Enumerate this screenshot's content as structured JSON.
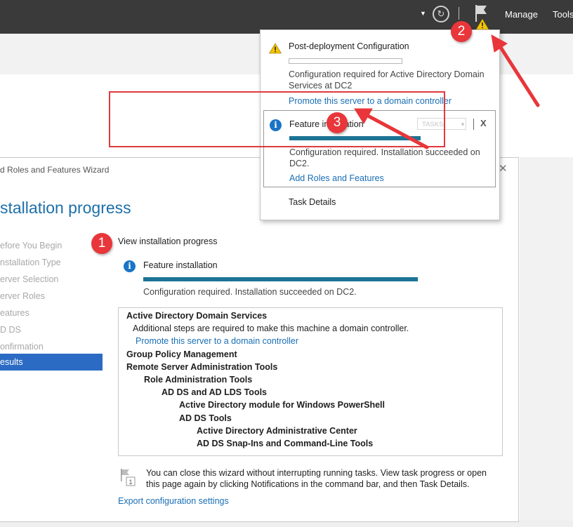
{
  "topbar": {
    "menu_manage": "Manage",
    "menu_tools": "Tools",
    "refresh_glyph": "↻",
    "dropdown_glyph": "▼"
  },
  "wizard": {
    "title": "d Roles and Features Wizard",
    "close_glyph": "✕",
    "heading": "stallation progress",
    "nav": [
      {
        "label": "efore You Begin"
      },
      {
        "label": "nstallation Type"
      },
      {
        "label": "erver Selection"
      },
      {
        "label": "erver Roles"
      },
      {
        "label": "eatures"
      },
      {
        "label": "D DS"
      },
      {
        "label": "onfirmation"
      },
      {
        "label": "esults"
      }
    ],
    "view_label": "View installation progress",
    "feature": {
      "title": "Feature installation",
      "progress": 1.0,
      "status": "Configuration required. Installation succeeded on DC2."
    },
    "results": [
      {
        "text": "Active Directory Domain Services",
        "style": "b",
        "indent": 0
      },
      {
        "text": "Additional steps are required to make this machine a domain controller.",
        "style": "n",
        "indent": 1
      },
      {
        "text": "Promote this server to a domain controller",
        "style": "lnk",
        "indent": 1
      },
      {
        "text": "Group Policy Management",
        "style": "b",
        "indent": 0
      },
      {
        "text": "Remote Server Administration Tools",
        "style": "b",
        "indent": 0
      },
      {
        "text": "Role Administration Tools",
        "style": "b",
        "indent": 1
      },
      {
        "text": "AD DS and AD LDS Tools",
        "style": "b",
        "indent": 2
      },
      {
        "text": "Active Directory module for Windows PowerShell",
        "style": "b",
        "indent": 3
      },
      {
        "text": "AD DS Tools",
        "style": "b",
        "indent": 3
      },
      {
        "text": "Active Directory Administrative Center",
        "style": "b",
        "indent": 4
      },
      {
        "text": "AD DS Snap-Ins and Command-Line Tools",
        "style": "b",
        "indent": 4
      }
    ],
    "note": "You can close this wizard without interrupting running tasks. View task progress or open this page again by clicking Notifications in the command bar, and then Task Details.",
    "note_badge": "1",
    "export_link": "Export configuration settings"
  },
  "notifications": {
    "post_deploy": {
      "title": "Post-deployment Configuration",
      "progress": 0,
      "text": "Configuration required for Active Directory Domain Services at DC2",
      "link": "Promote this server to a domain controller"
    },
    "feature": {
      "title": "Feature installation",
      "tasks_label": "TASKS",
      "close_label": "X",
      "progress": 1.0,
      "text": "Configuration required. Installation succeeded on DC2.",
      "link": "Add Roles and Features"
    },
    "task_details": "Task Details"
  },
  "callouts": [
    "1",
    "2",
    "3"
  ],
  "colors": {
    "accent": "#1b7494",
    "callout": "#e8363a",
    "link": "#1a6fb5",
    "selected_nav": "#2b6bc4"
  }
}
